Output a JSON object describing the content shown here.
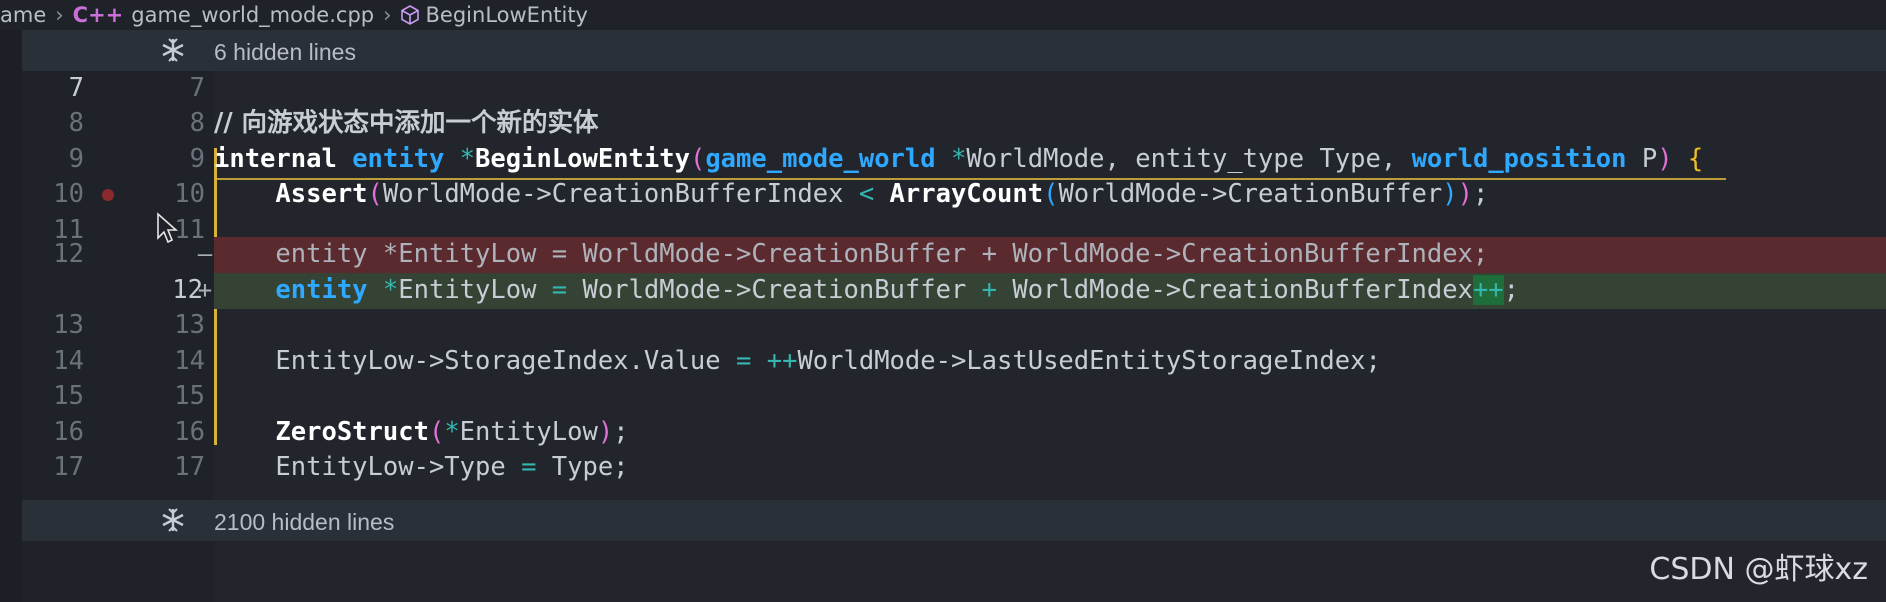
{
  "breadcrumb": {
    "items": [
      "ame",
      "game_world_mode.cpp",
      "BeginLowEntity"
    ],
    "cpp_icon_text": "C++"
  },
  "folds": [
    {
      "label": "6 hidden lines"
    },
    {
      "label": "2100 hidden lines"
    }
  ],
  "lines": [
    {
      "old": "7",
      "new": "7"
    },
    {
      "old": "8",
      "new": "8",
      "comment": "// 向游戏状态中添加一个新的实体"
    },
    {
      "old": "9",
      "new": "9"
    },
    {
      "old": "10",
      "new": "10"
    },
    {
      "old": "11",
      "new": "11"
    },
    {
      "old": "12",
      "new": "",
      "marker": "—"
    },
    {
      "old": "",
      "new": "12",
      "marker": "+"
    },
    {
      "old": "13",
      "new": "13"
    },
    {
      "old": "14",
      "new": "14"
    },
    {
      "old": "15",
      "new": "15"
    },
    {
      "old": "16",
      "new": "16"
    },
    {
      "old": "17",
      "new": "17"
    }
  ],
  "tokens": {
    "l9": {
      "internal": "internal",
      "entity": "entity",
      "star1": "*",
      "fn": "BeginLowEntity",
      "p_open": "(",
      "t1": "game_mode_world",
      "star2": "*",
      "a1": "WorldMode, entity_type Type, ",
      "t2": "world_position",
      "a2": " P",
      "p_close": ")",
      "brace": " {"
    },
    "l10": {
      "fn": "Assert",
      "p1": "(",
      "a1": "WorldMode->CreationBufferIndex ",
      "lt": "<",
      "sp": " ",
      "fn2": "ArrayCount",
      "p2": "(",
      "a2": "WorldMode->CreationBuffer",
      "p3": ")",
      "p4": ")",
      "semi": ";"
    },
    "l12d": {
      "text": "entity *EntityLow = WorldMode->CreationBuffer + WorldMode->CreationBufferIndex;"
    },
    "l12a": {
      "t": "entity",
      "star": " *",
      "a1": "EntityLow ",
      "eq": "=",
      "a2": " WorldMode->CreationBuffer ",
      "plus": "+",
      "a3": " WorldMode->CreationBufferIndex",
      "inc": "++",
      "semi": ";"
    },
    "l14": {
      "a1": "EntityLow->StorageIndex.Value ",
      "eq": "=",
      "sp": " ",
      "inc": "++",
      "a2": "WorldMode->LastUsedEntityStorageIndex;"
    },
    "l16": {
      "fn": "ZeroStruct",
      "p1": "(",
      "star": "*",
      "a1": "EntityLow",
      "p2": ")",
      "semi": ";"
    },
    "l17": {
      "a1": "EntityLow->Type ",
      "eq": "=",
      "a2": " Type;"
    }
  },
  "watermark": "CSDN @虾球xz",
  "colors": {
    "background": "#1f2329",
    "deleted_line": "#5a2a2e",
    "added_line": "#354334",
    "change_bar": "#d9b23a",
    "type_blue": "#2fa8ff",
    "operator_teal": "#35b6b0"
  }
}
